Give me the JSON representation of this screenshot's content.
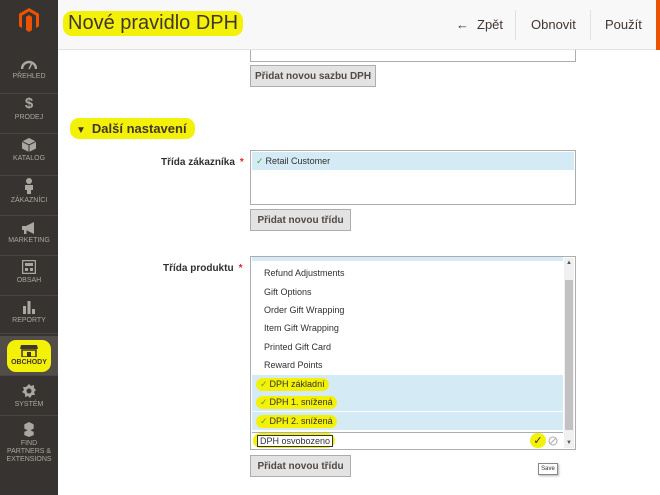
{
  "header": {
    "title": "Nové pravidlo DPH",
    "back_label": "Zpět",
    "reset_label": "Obnovit",
    "apply_label": "Použít"
  },
  "sidebar": {
    "items": [
      {
        "label": "PŘEHLED",
        "icon": "dashboard-icon"
      },
      {
        "label": "PRODEJ",
        "icon": "dollar-icon"
      },
      {
        "label": "KATALOG",
        "icon": "box-icon"
      },
      {
        "label": "ZÁKAZNÍCI",
        "icon": "person-icon"
      },
      {
        "label": "MARKETING",
        "icon": "megaphone-icon"
      },
      {
        "label": "OBSAH",
        "icon": "layout-icon"
      },
      {
        "label": "REPORTY",
        "icon": "bar-chart-icon"
      },
      {
        "label": "OBCHODY",
        "icon": "store-icon"
      },
      {
        "label": "SYSTÉM",
        "icon": "gear-icon"
      },
      {
        "label": "FIND PARTNERS & EXTENSIONS",
        "icon": "cubes-icon"
      }
    ]
  },
  "main": {
    "add_rate_button": "Přidat novou sazbu DPH",
    "section_title": "Další nastavení",
    "customer_class_label": "Třída zákazníka",
    "customer_options": [
      {
        "label": "Retail Customer",
        "selected": true
      }
    ],
    "add_class_button_1": "Přidat novou třídu",
    "product_class_label": "Třída produktu",
    "product_options": [
      {
        "label": "Refund Adjustments",
        "selected": false
      },
      {
        "label": "Gift Options",
        "selected": false
      },
      {
        "label": "Order Gift Wrapping",
        "selected": false
      },
      {
        "label": "Item Gift Wrapping",
        "selected": false
      },
      {
        "label": "Printed Gift Card",
        "selected": false
      },
      {
        "label": "Reward Points",
        "selected": false
      },
      {
        "label": "DPH základní",
        "selected": true
      },
      {
        "label": "DPH 1. snížená",
        "selected": true
      },
      {
        "label": "DPH 2. snížená",
        "selected": true
      }
    ],
    "new_item_value": "DPH osvobozeno",
    "add_class_button_2": "Přidat novou třídu",
    "tooltip": "Save"
  },
  "colors": {
    "sidebar_bg": "#373330",
    "highlight": "#f4f108",
    "accent_orange": "#eb5202",
    "selected_bg": "#d4ebf5",
    "check_green": "#4c9f3e"
  }
}
